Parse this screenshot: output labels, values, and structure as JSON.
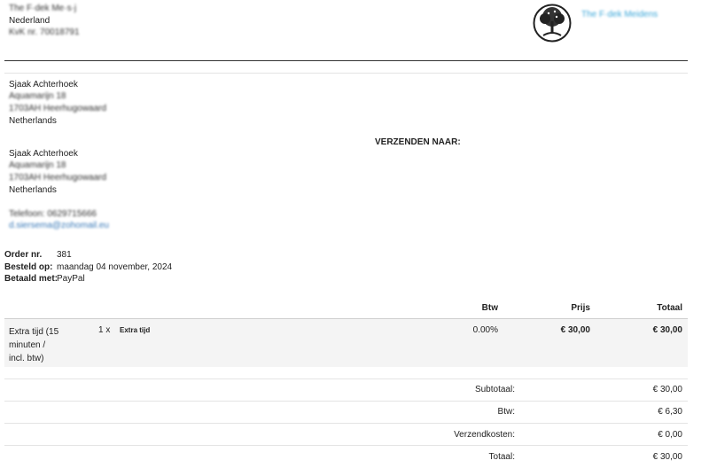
{
  "shop": {
    "name": "The F·dek Me·s·j",
    "country": "Nederland",
    "kvk": "KvK nr. 70018791",
    "logo_text": "The F·dek Meidens"
  },
  "billing": {
    "name": "Sjaak Achterhoek",
    "street": "Aquamarijn 18",
    "city": "1703AH Heerhugowaard",
    "country": "Netherlands"
  },
  "shipping_heading": "VERZENDEN NAAR:",
  "shipping": {
    "name": "Sjaak Achterhoek",
    "street": "Aquamarijn 18",
    "city": "1703AH Heerhugowaard",
    "country": "Netherlands",
    "phone": "Telefoon: 0629715666",
    "email": "d.siersema@zohomail.eu"
  },
  "order": {
    "number_label": "Order nr.",
    "number": "381",
    "date_label": "Besteld op:",
    "date": "maandag 04 november, 2024",
    "payment_label": "Betaald met:",
    "payment": "PayPal"
  },
  "table": {
    "headers": {
      "btw": "Btw",
      "price": "Prijs",
      "total": "Totaal"
    },
    "item": {
      "name_line1": "Extra tijd (15",
      "name_line2": "minuten /",
      "name_line3": "incl. btw)",
      "qty": "1 x",
      "desc": "Extra tijd",
      "btw": "0.00%",
      "price": "€ 30,00",
      "total": "€ 30,00"
    }
  },
  "totals": [
    {
      "label": "Subtotaal:",
      "value": "€ 30,00"
    },
    {
      "label": "Btw:",
      "value": "€ 6,30"
    },
    {
      "label": "Verzendkosten:",
      "value": "€ 0,00"
    },
    {
      "label": "Totaal:",
      "value": "€ 30,00"
    }
  ]
}
